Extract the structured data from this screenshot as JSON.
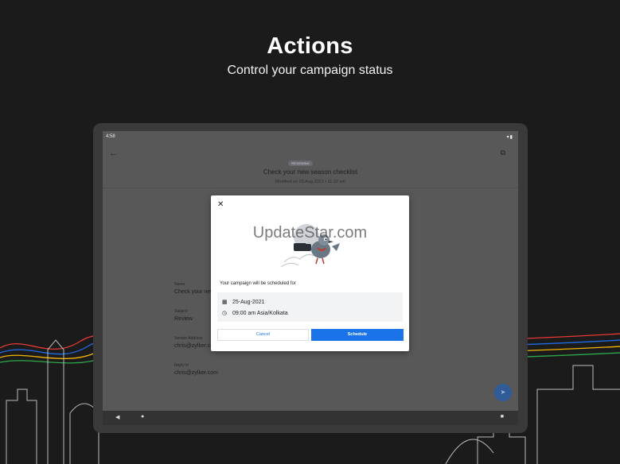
{
  "hero": {
    "title": "Actions",
    "subtitle": "Control your campaign status"
  },
  "device": {
    "status_time": "4:58",
    "status_icons": "▾▮",
    "badge": "REVIEWING",
    "campaign_title": "Check your new season checklist",
    "modified": "Modified on 03 Aug 2021  •  11:32 am"
  },
  "form": {
    "name_label": "Name",
    "name_value": "Check your new",
    "subject_label": "Subject",
    "subject_value": "Review",
    "sender_label": "Sender Address",
    "sender_value": "chris@zylker.com",
    "reply_label": "Reply to",
    "reply_value": "chris@zylker.com"
  },
  "dialog": {
    "watermark": "UpdateStar.com",
    "schedule_text": "Your campaign will be scheduled for",
    "date": "25-Aug-2021",
    "time": "09:00 am Asia/Kolkata",
    "cancel_label": "Cancel",
    "schedule_label": "Schedule"
  },
  "icons": {
    "back": "arrow-left-icon",
    "copy": "copy-icon",
    "close": "close-icon",
    "calendar": "calendar-icon",
    "clock": "clock-icon",
    "send": "send-icon"
  },
  "colors": {
    "background": "#1b1b1b",
    "primary": "#1a73e8",
    "scrim": "#585858",
    "stripe_red": "#e53935",
    "stripe_blue": "#1e6be6",
    "stripe_yellow": "#f5b400",
    "stripe_green": "#2ea84a"
  }
}
